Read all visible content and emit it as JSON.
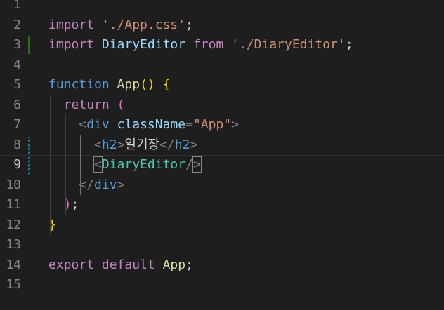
{
  "editor": {
    "lines": [
      {
        "num": "1",
        "tokens": []
      },
      {
        "num": "2",
        "tokens": [
          {
            "t": "import",
            "c": "kw"
          },
          {
            "t": " ",
            "c": "plain"
          },
          {
            "t": "'./App.css'",
            "c": "str"
          },
          {
            "t": ";",
            "c": "plain"
          }
        ]
      },
      {
        "num": "3",
        "tokens": [
          {
            "t": "import",
            "c": "kw"
          },
          {
            "t": " ",
            "c": "plain"
          },
          {
            "t": "DiaryEditor",
            "c": "id"
          },
          {
            "t": " ",
            "c": "plain"
          },
          {
            "t": "from",
            "c": "kw"
          },
          {
            "t": " ",
            "c": "plain"
          },
          {
            "t": "'./DiaryEditor'",
            "c": "str"
          },
          {
            "t": ";",
            "c": "plain"
          }
        ]
      },
      {
        "num": "4",
        "tokens": []
      },
      {
        "num": "5",
        "tokens": [
          {
            "t": "function",
            "c": "decl"
          },
          {
            "t": " ",
            "c": "plain"
          },
          {
            "t": "App",
            "c": "fn"
          },
          {
            "t": "()",
            "c": "br1"
          },
          {
            "t": " ",
            "c": "plain"
          },
          {
            "t": "{",
            "c": "br1"
          }
        ]
      },
      {
        "num": "6",
        "tokens": [
          {
            "t": "  ",
            "c": "plain"
          },
          {
            "t": "return",
            "c": "kw"
          },
          {
            "t": " ",
            "c": "plain"
          },
          {
            "t": "(",
            "c": "br2"
          }
        ]
      },
      {
        "num": "7",
        "tokens": [
          {
            "t": "    ",
            "c": "plain"
          },
          {
            "t": "<",
            "c": "angle"
          },
          {
            "t": "div",
            "c": "tag"
          },
          {
            "t": " ",
            "c": "plain"
          },
          {
            "t": "className",
            "c": "attr"
          },
          {
            "t": "=",
            "c": "plain"
          },
          {
            "t": "\"App\"",
            "c": "str"
          },
          {
            "t": ">",
            "c": "angle"
          }
        ]
      },
      {
        "num": "8",
        "tokens": [
          {
            "t": "      ",
            "c": "plain"
          },
          {
            "t": "<",
            "c": "angle"
          },
          {
            "t": "h2",
            "c": "tag"
          },
          {
            "t": ">",
            "c": "angle"
          },
          {
            "t": "일기장",
            "c": "text"
          },
          {
            "t": "</",
            "c": "angle"
          },
          {
            "t": "h2",
            "c": "tag"
          },
          {
            "t": ">",
            "c": "angle"
          }
        ]
      },
      {
        "num": "9",
        "tokens": [
          {
            "t": "      ",
            "c": "plain"
          },
          {
            "t": "<",
            "c": "angle",
            "match": true
          },
          {
            "t": "DiaryEditor",
            "c": "comp"
          },
          {
            "t": "/",
            "c": "angle"
          },
          {
            "t": ">",
            "c": "angle",
            "match": true
          }
        ]
      },
      {
        "num": "10",
        "tokens": [
          {
            "t": "    ",
            "c": "plain"
          },
          {
            "t": "</",
            "c": "angle"
          },
          {
            "t": "div",
            "c": "tag"
          },
          {
            "t": ">",
            "c": "angle"
          }
        ]
      },
      {
        "num": "11",
        "tokens": [
          {
            "t": "  ",
            "c": "plain"
          },
          {
            "t": ")",
            "c": "br2"
          },
          {
            "t": ";",
            "c": "plain"
          }
        ]
      },
      {
        "num": "12",
        "tokens": [
          {
            "t": "}",
            "c": "br1"
          }
        ]
      },
      {
        "num": "13",
        "tokens": []
      },
      {
        "num": "14",
        "tokens": [
          {
            "t": "export",
            "c": "kw"
          },
          {
            "t": " ",
            "c": "plain"
          },
          {
            "t": "default",
            "c": "kw"
          },
          {
            "t": " ",
            "c": "plain"
          },
          {
            "t": "App",
            "c": "fn"
          },
          {
            "t": ";",
            "c": "plain"
          }
        ]
      },
      {
        "num": "15",
        "tokens": []
      }
    ],
    "current_line": "9",
    "colors": {
      "background": "#1e1e1e",
      "keyword": "#c586c0",
      "declaration": "#569cd6",
      "string": "#ce9178",
      "function": "#dcdcaa",
      "identifier": "#9cdcfe",
      "component": "#4ec9b0",
      "line_number": "#858585",
      "diff_modified": "#2f6b1e",
      "diff_added": "#1b81a8"
    }
  }
}
